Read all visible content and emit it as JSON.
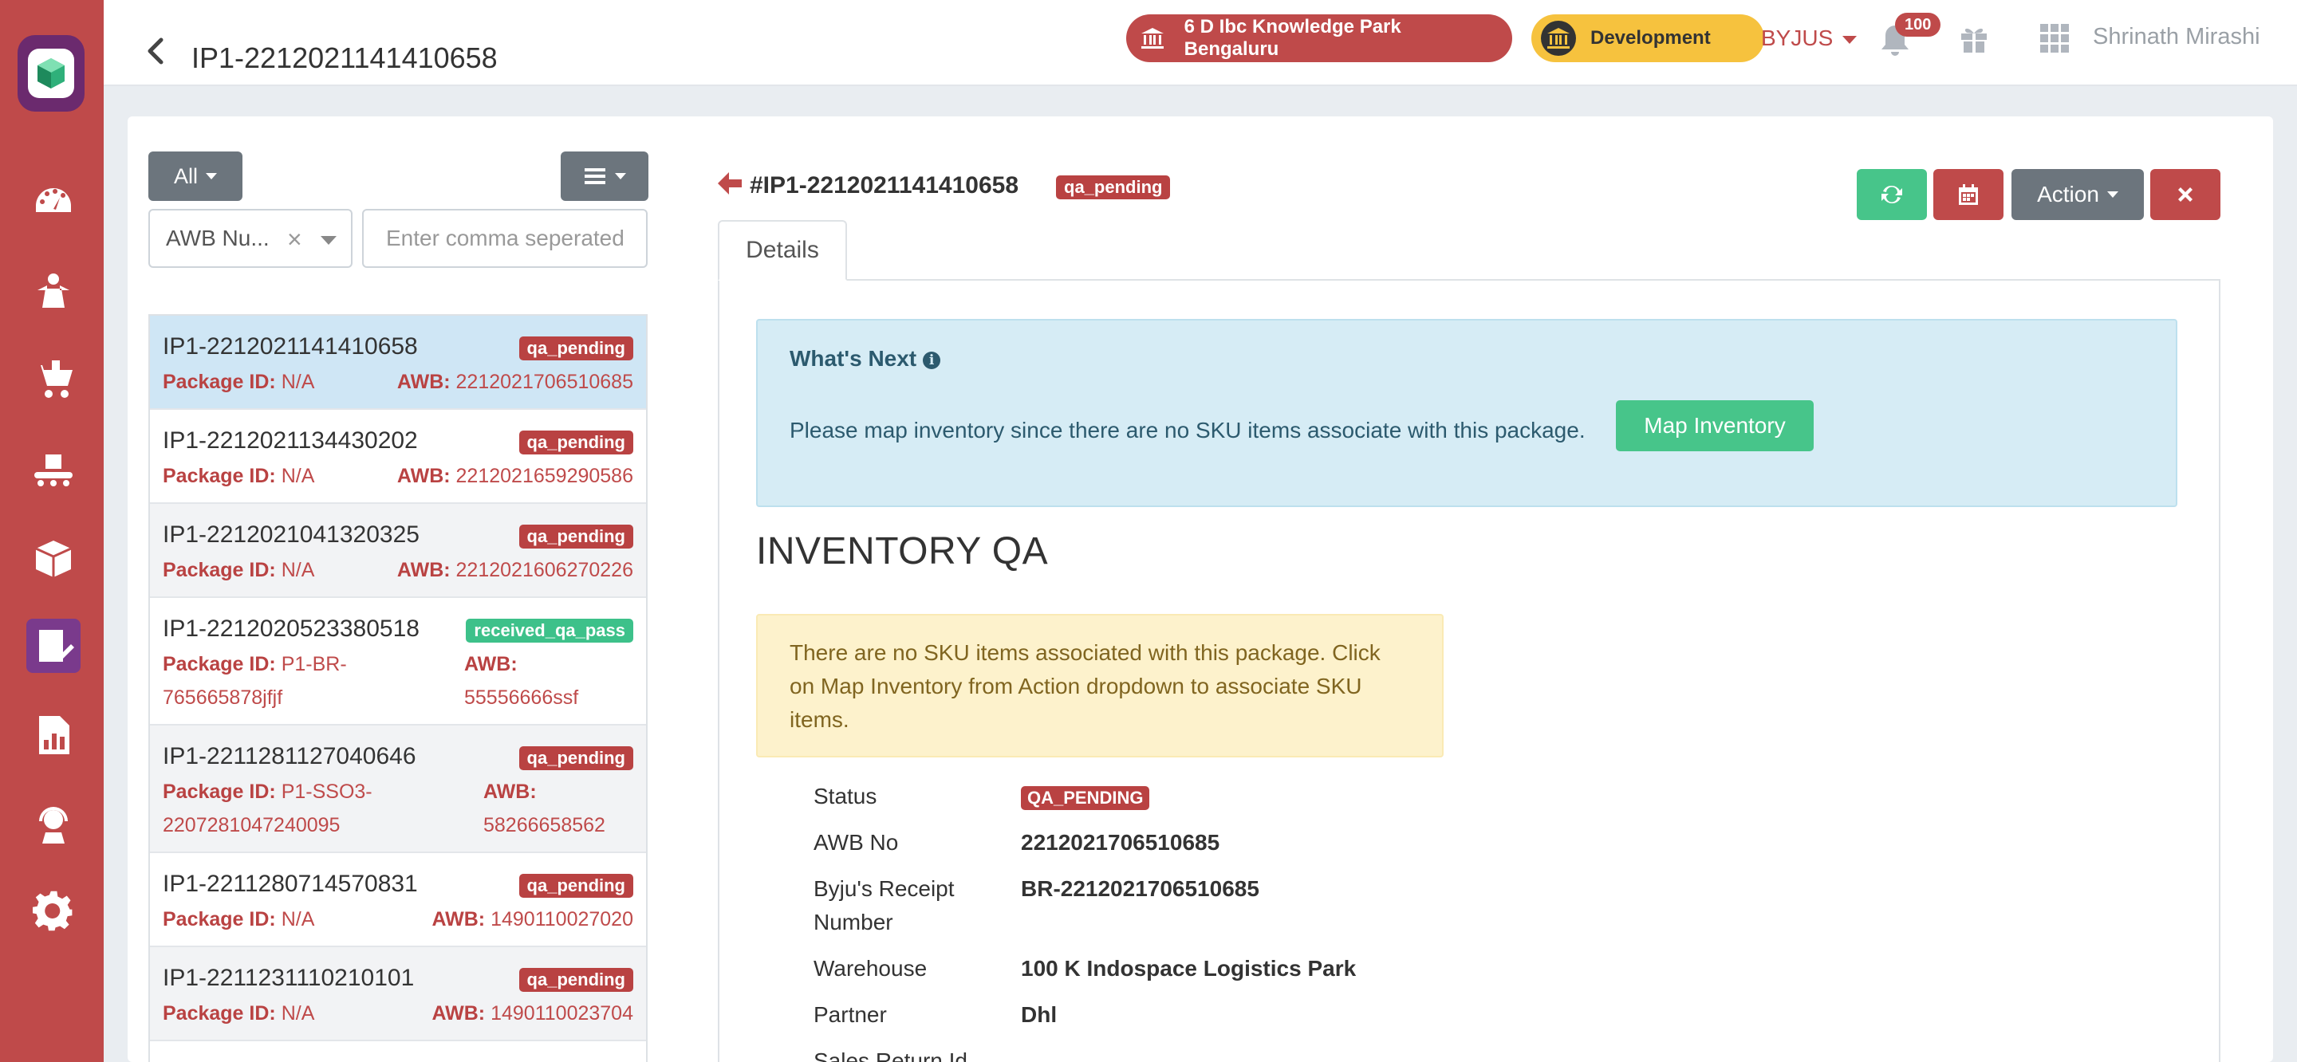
{
  "header": {
    "title": "IP1-2212021141410658",
    "location": "6 D Ibc Knowledge Park Bengaluru",
    "environment": "Development",
    "org": "BYJUS",
    "notification_count": "100",
    "user_name": "Shrinath Mirashi"
  },
  "left_panel": {
    "filter_label": "All",
    "search_type": "AWB Nu...",
    "search_placeholder": "Enter comma seperated",
    "items": [
      {
        "id": "IP1-2212021141410658",
        "status": "qa_pending",
        "package_label": "Package ID:",
        "package_id": "N/A",
        "awb_label": "AWB:",
        "awb": "2212021706510685"
      },
      {
        "id": "IP1-2212021134430202",
        "status": "qa_pending",
        "package_label": "Package ID:",
        "package_id": "N/A",
        "awb_label": "AWB:",
        "awb": "2212021659290586"
      },
      {
        "id": "IP1-2212021041320325",
        "status": "qa_pending",
        "package_label": "Package ID:",
        "package_id": "N/A",
        "awb_label": "AWB:",
        "awb": "2212021606270226"
      },
      {
        "id": "IP1-2212020523380518",
        "status": "received_qa_pass",
        "package_label": "Package ID:",
        "package_id_line1": "P1-BR-",
        "package_id_line2": "765665878jfjf",
        "awb_label": "AWB:",
        "awb": "55556666ssf"
      },
      {
        "id": "IP1-2211281127040646",
        "status": "qa_pending",
        "package_label": "Package ID:",
        "package_id_line1": "P1-SSO3-",
        "package_id_line2": "2207281047240095",
        "awb_label": "AWB:",
        "awb": "58266658562"
      },
      {
        "id": "IP1-2211280714570831",
        "status": "qa_pending",
        "package_label": "Package ID:",
        "package_id": "N/A",
        "awb_label": "AWB:",
        "awb": "1490110027020"
      },
      {
        "id": "IP1-2211231110210101",
        "status": "qa_pending",
        "package_label": "Package ID:",
        "package_id": "N/A",
        "awb_label": "AWB:",
        "awb": "1490110023704"
      }
    ]
  },
  "detail": {
    "title": "#IP1-2212021141410658",
    "status_badge": "qa_pending",
    "action_label": "Action",
    "tab_details": "Details",
    "whats_next_title": "What's Next",
    "whats_next_text": "Please map inventory since there are no SKU items associate with this package.",
    "map_inventory_label": "Map Inventory",
    "section_title": "INVENTORY QA",
    "warning_text": "There are no SKU items associated with this package. Click on Map Inventory from Action dropdown to associate SKU items.",
    "fields": {
      "status_label": "Status",
      "status_value": "QA_PENDING",
      "awb_label": "AWB No",
      "awb_value": "2212021706510685",
      "receipt_label_line1": "Byju's Receipt",
      "receipt_label_line2": "Number",
      "receipt_value": "BR-2212021706510685",
      "warehouse_label": "Warehouse",
      "warehouse_value": "100 K Indospace Logistics Park",
      "partner_label": "Partner",
      "partner_value": "Dhl",
      "sales_return_label": "Sales Return Id"
    }
  },
  "colors": {
    "brand_red": "#bf4a4a",
    "success_green": "#47c58a",
    "info_bg": "#d6ecf5",
    "warning_bg": "#fdf2cc"
  },
  "icons": {
    "sidebar": [
      "dashboard-icon",
      "inbound-icon",
      "cart-icon",
      "conveyor-icon",
      "package-icon",
      "qa-icon",
      "reports-icon",
      "support-icon",
      "settings-icon"
    ]
  }
}
